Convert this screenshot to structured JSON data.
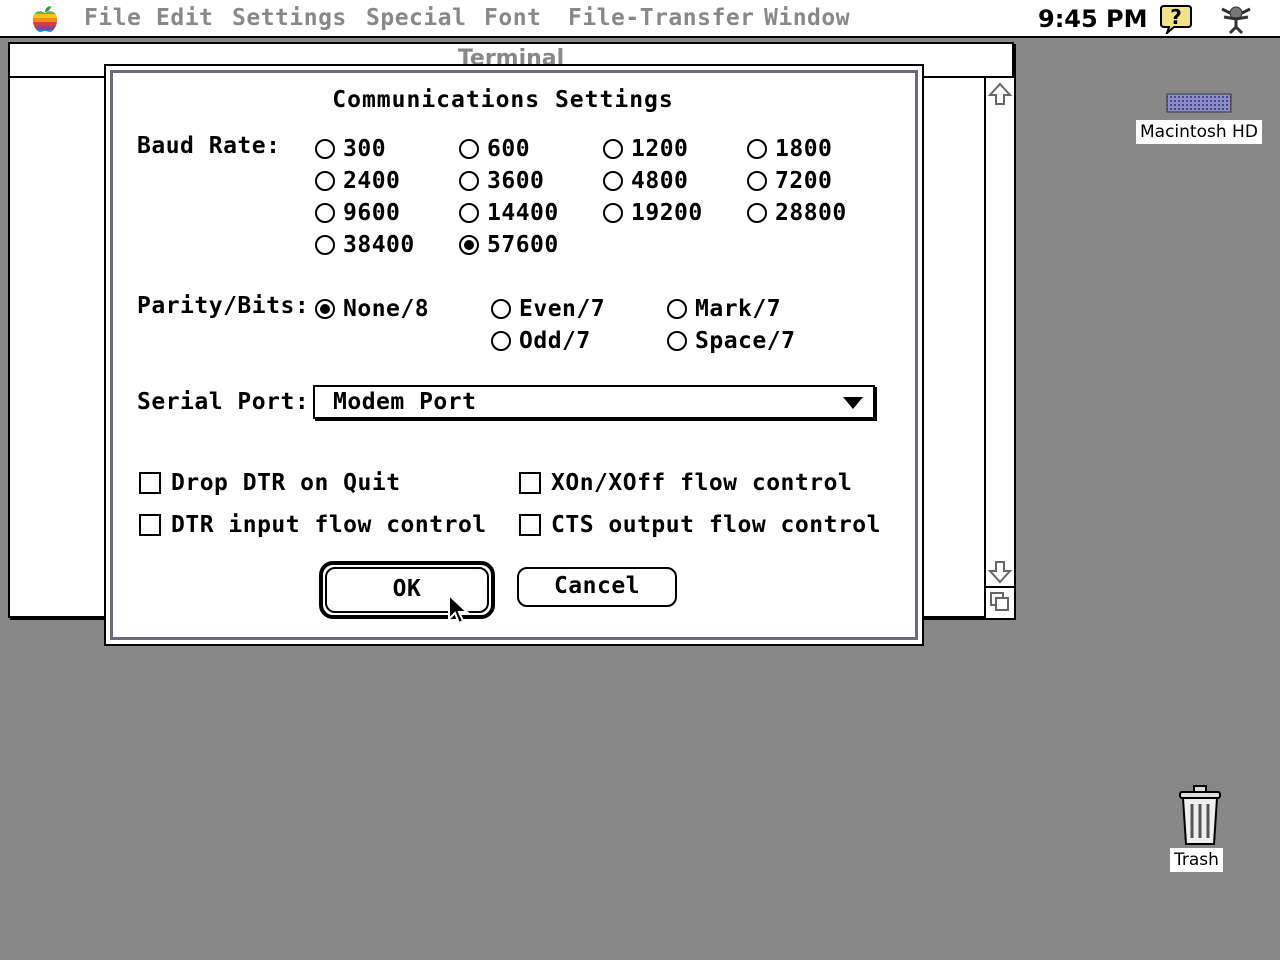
{
  "menubar": {
    "items": [
      "File",
      "Edit",
      "Settings",
      "Special",
      "Font",
      "File-Transfer",
      "Window"
    ],
    "clock": "9:45 PM",
    "apple_icon": "apple-rainbow-icon",
    "help_icon": "balloon-help-icon",
    "app_icon": "application-menu-icon"
  },
  "terminal_window": {
    "title": "Terminal"
  },
  "desktop": {
    "hard_disk_label": "Macintosh HD",
    "trash_label": "Trash",
    "background_color": "#888888"
  },
  "dialog": {
    "title": "Communications Settings",
    "baud_rate": {
      "label": "Baud Rate:",
      "options": [
        "300",
        "600",
        "1200",
        "1800",
        "2400",
        "3600",
        "4800",
        "7200",
        "9600",
        "14400",
        "19200",
        "28800",
        "38400",
        "57600"
      ],
      "selected": "57600"
    },
    "parity": {
      "label": "Parity/Bits:",
      "options": [
        "None/8",
        "Even/7",
        "Mark/7",
        "Odd/7",
        "Space/7"
      ],
      "selected": "None/8"
    },
    "serial_port": {
      "label": "Serial Port:",
      "value": "Modem Port"
    },
    "checkboxes": [
      {
        "label": "Drop DTR on Quit",
        "checked": false
      },
      {
        "label": "XOn/XOff flow control",
        "checked": false
      },
      {
        "label": "DTR input flow control",
        "checked": false
      },
      {
        "label": "CTS output flow control",
        "checked": false
      }
    ],
    "ok_label": "OK",
    "cancel_label": "Cancel"
  }
}
